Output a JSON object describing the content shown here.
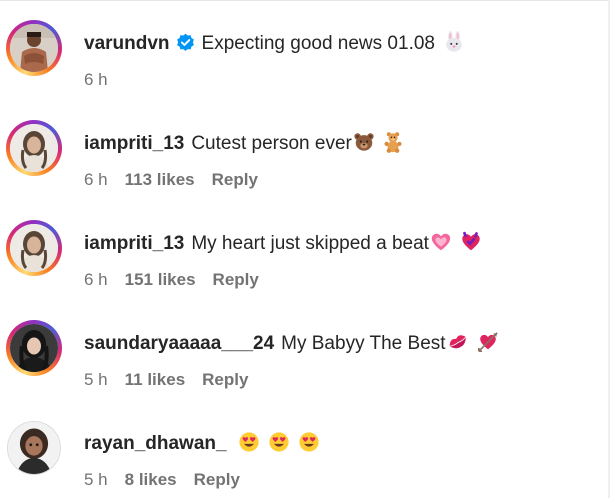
{
  "comments": [
    {
      "user": "varundvn",
      "verified": true,
      "text": "Expecting good news 01.08",
      "emojis": [
        "rabbit-face"
      ],
      "time": "6 h",
      "likes": "",
      "reply": ""
    },
    {
      "user": "iampriti_13",
      "verified": false,
      "text": "Cutest person ever",
      "emojis": [
        "bear-face",
        "teddy-bear"
      ],
      "time": "6 h",
      "likes": "113 likes",
      "reply": "Reply"
    },
    {
      "user": "iampriti_13",
      "verified": false,
      "text": "My heart just skipped a beat",
      "emojis": [
        "growing-heart",
        "beating-heart"
      ],
      "time": "6 h",
      "likes": "151 likes",
      "reply": "Reply"
    },
    {
      "user": "saundaryaaaaa___24",
      "verified": false,
      "text": "My Babyy The Best",
      "emojis": [
        "kiss-mark",
        "heart-with-arrow"
      ],
      "time": "5 h",
      "likes": "11 likes",
      "reply": "Reply"
    },
    {
      "user": "rayan_dhawan_",
      "verified": false,
      "text": "",
      "emojis": [
        "heart-eyes",
        "heart-eyes",
        "heart-eyes"
      ],
      "time": "5 h",
      "likes": "8 likes",
      "reply": "Reply"
    }
  ],
  "colors": {
    "verified": "#0095f6",
    "meta": "#737373",
    "text": "#262626"
  }
}
